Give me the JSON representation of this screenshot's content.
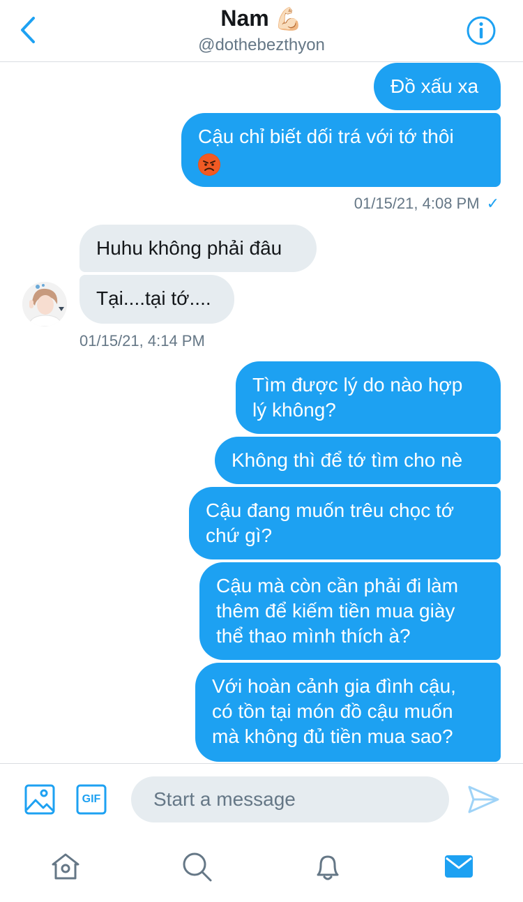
{
  "header": {
    "title": "Nam",
    "title_emoji": "💪🏻",
    "handle": "@dothebezthyon",
    "back_icon": "chevron-left-icon",
    "info_icon": "info-icon"
  },
  "messages": [
    {
      "direction": "out",
      "text": "Đồ xấu xa"
    },
    {
      "direction": "out",
      "text": "Cậu chỉ biết dối trá với tớ thôi",
      "emoji": "angry-face"
    },
    {
      "timestamp": "01/15/21, 4:08 PM",
      "status": "✓"
    },
    {
      "direction": "in",
      "text": "Huhu không phải đâu"
    },
    {
      "direction": "in",
      "text": "Tại....tại tớ...."
    },
    {
      "timestamp": "01/15/21, 4:14 PM"
    },
    {
      "direction": "out",
      "line1": "Tìm được lý do nào hợp",
      "line2": "lý không?"
    },
    {
      "direction": "out",
      "text": "Không thì để tớ tìm cho nè"
    },
    {
      "direction": "out",
      "line1": "Cậu đang muốn trêu chọc tớ",
      "line2": "chứ gì?"
    },
    {
      "direction": "out",
      "line1": "Cậu mà còn cần phải đi làm",
      "line2": "thêm để kiếm tiền mua giày",
      "line3": "thể thao mình thích à?"
    },
    {
      "direction": "out",
      "line1": "Với hoàn cảnh gia đình cậu,",
      "line2": "có tồn tại món đồ cậu muốn",
      "line3": "mà không đủ tiền mua sao?"
    }
  ],
  "composer": {
    "placeholder": "Start a message",
    "gif_label": "GIF",
    "image_icon": "image-icon",
    "send_icon": "send-icon"
  },
  "tabbar": {
    "items": [
      "home-icon",
      "search-icon",
      "notifications-icon",
      "messages-icon"
    ],
    "active": "messages-icon"
  },
  "colors": {
    "accent": "#1da1f2",
    "incoming_bubble": "#e6ecf0",
    "muted_text": "#657786",
    "divider": "#d9dde1"
  }
}
